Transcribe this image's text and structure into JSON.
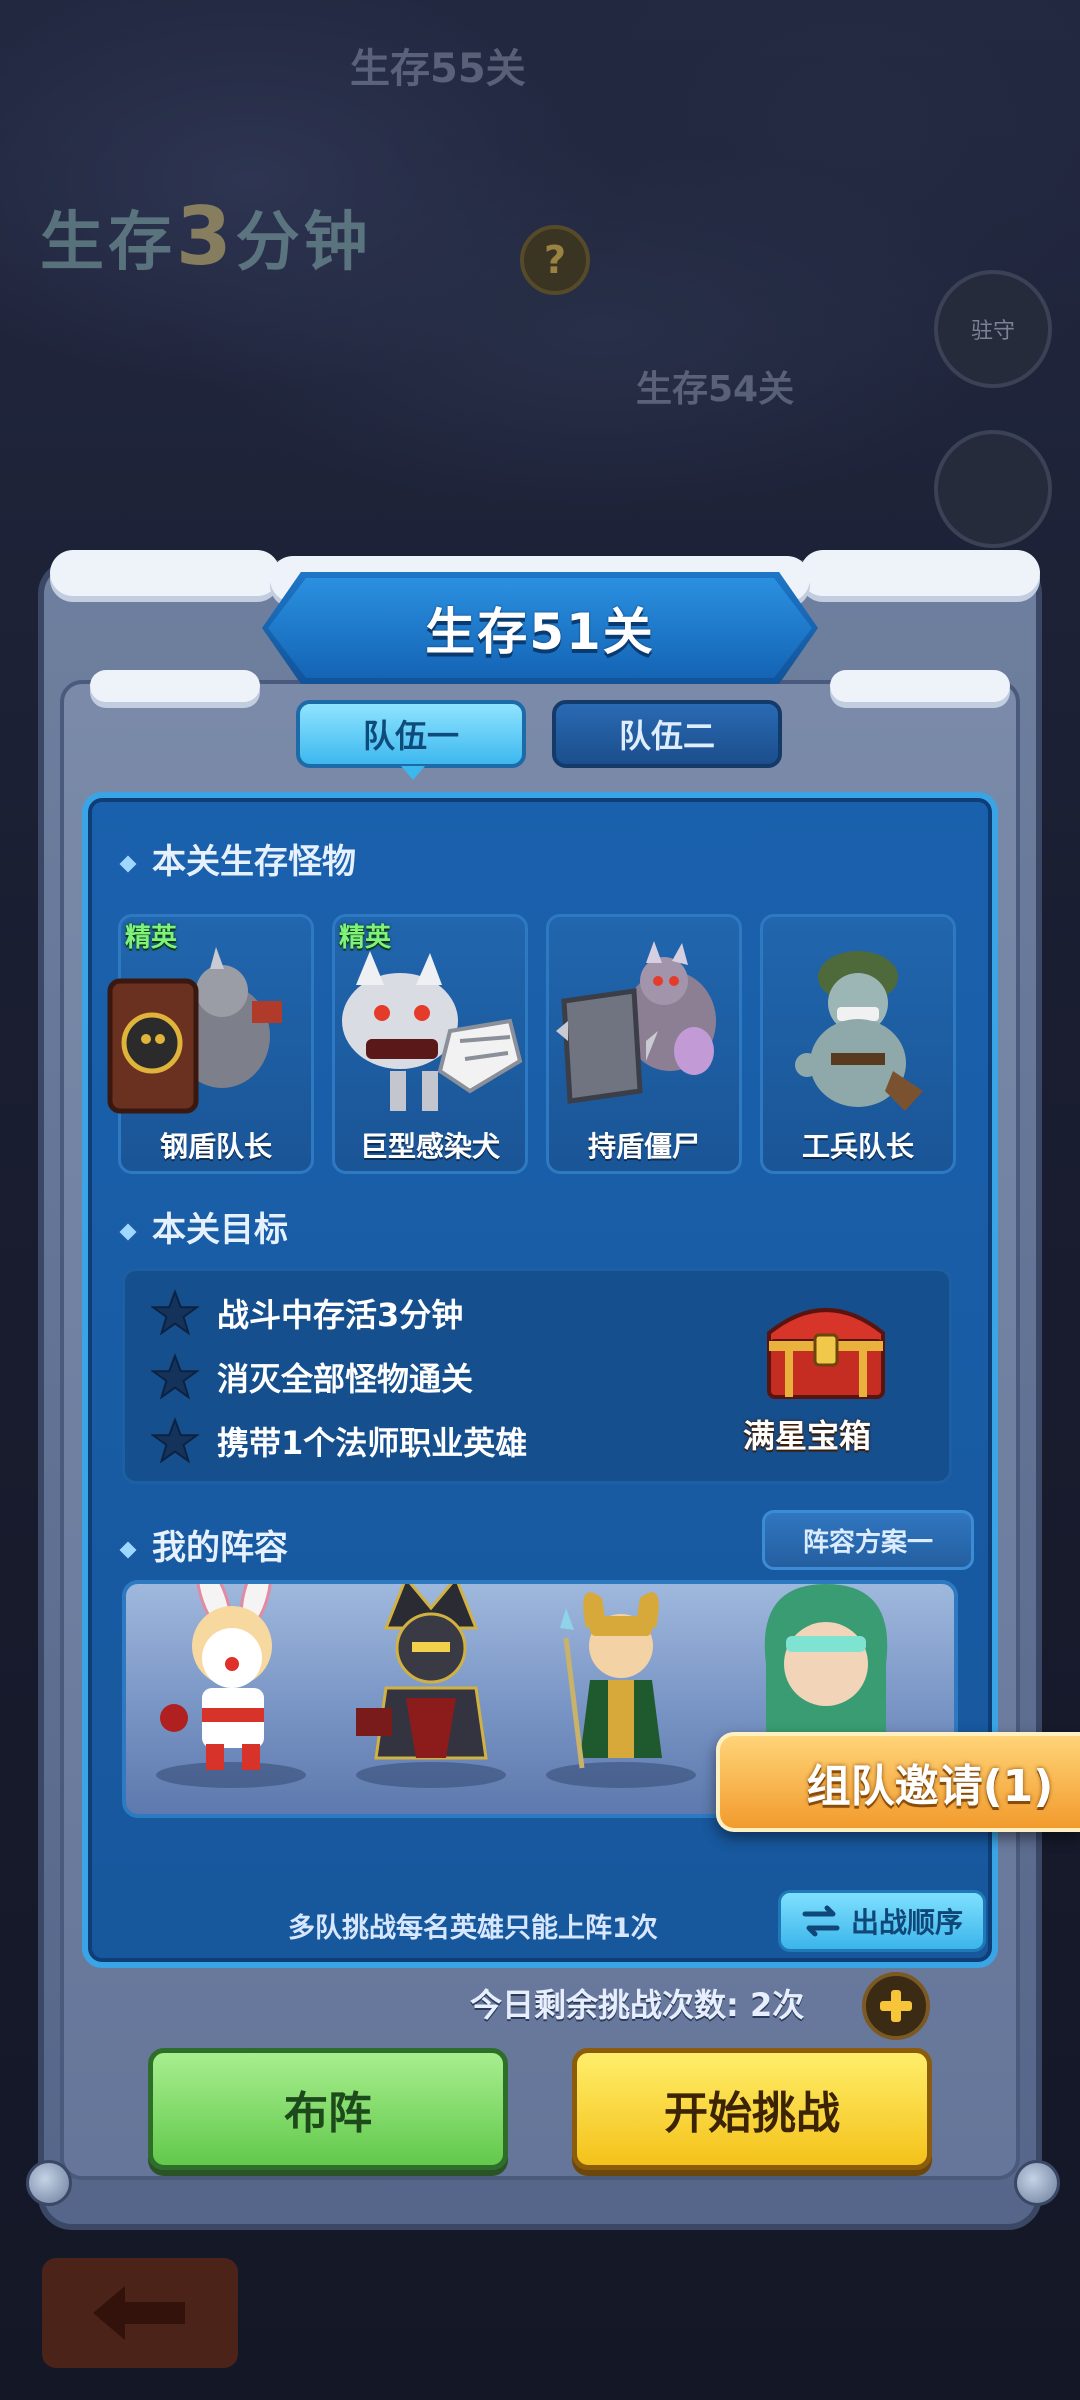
{
  "background": {
    "map_labels": [
      "生存55关",
      "生存54关"
    ],
    "survive_banner": {
      "prefix": "生存",
      "number": "3",
      "suffix": "分钟"
    },
    "help_badge": "?",
    "map_nodes": [
      "驻守",
      ""
    ]
  },
  "dialog": {
    "title": "生存51关",
    "tabs": [
      {
        "label": "队伍一",
        "active": true
      },
      {
        "label": "队伍二",
        "active": false
      }
    ],
    "monsters_section": {
      "title": "本关生存怪物",
      "monsters": [
        {
          "name": "钢盾队长",
          "tag": "精英"
        },
        {
          "name": "巨型感染犬",
          "tag": "精英"
        },
        {
          "name": "持盾僵尸",
          "tag": ""
        },
        {
          "name": "工兵队长",
          "tag": ""
        }
      ]
    },
    "goals_section": {
      "title": "本关目标",
      "goals": [
        "战斗中存活3分钟",
        "消灭全部怪物通关",
        "携带1个法师职业英雄"
      ],
      "reward_label": "满星宝箱"
    },
    "lineup_section": {
      "title": "我的阵容",
      "plan_button": "阵容方案一",
      "rule_text": "多队挑战每名英雄只能上阵1次",
      "order_button": "出战顺序"
    },
    "attempts_text": "今日剩余挑战次数: 2次",
    "formation_button": "布阵",
    "start_button": "开始挑战"
  },
  "team_invite": "组队邀请(1)",
  "colors": {
    "panel_blue": "#1a61ad",
    "green_button": "#62c94c",
    "yellow_button": "#f4c21a",
    "elite_green": "#7ff27a"
  }
}
